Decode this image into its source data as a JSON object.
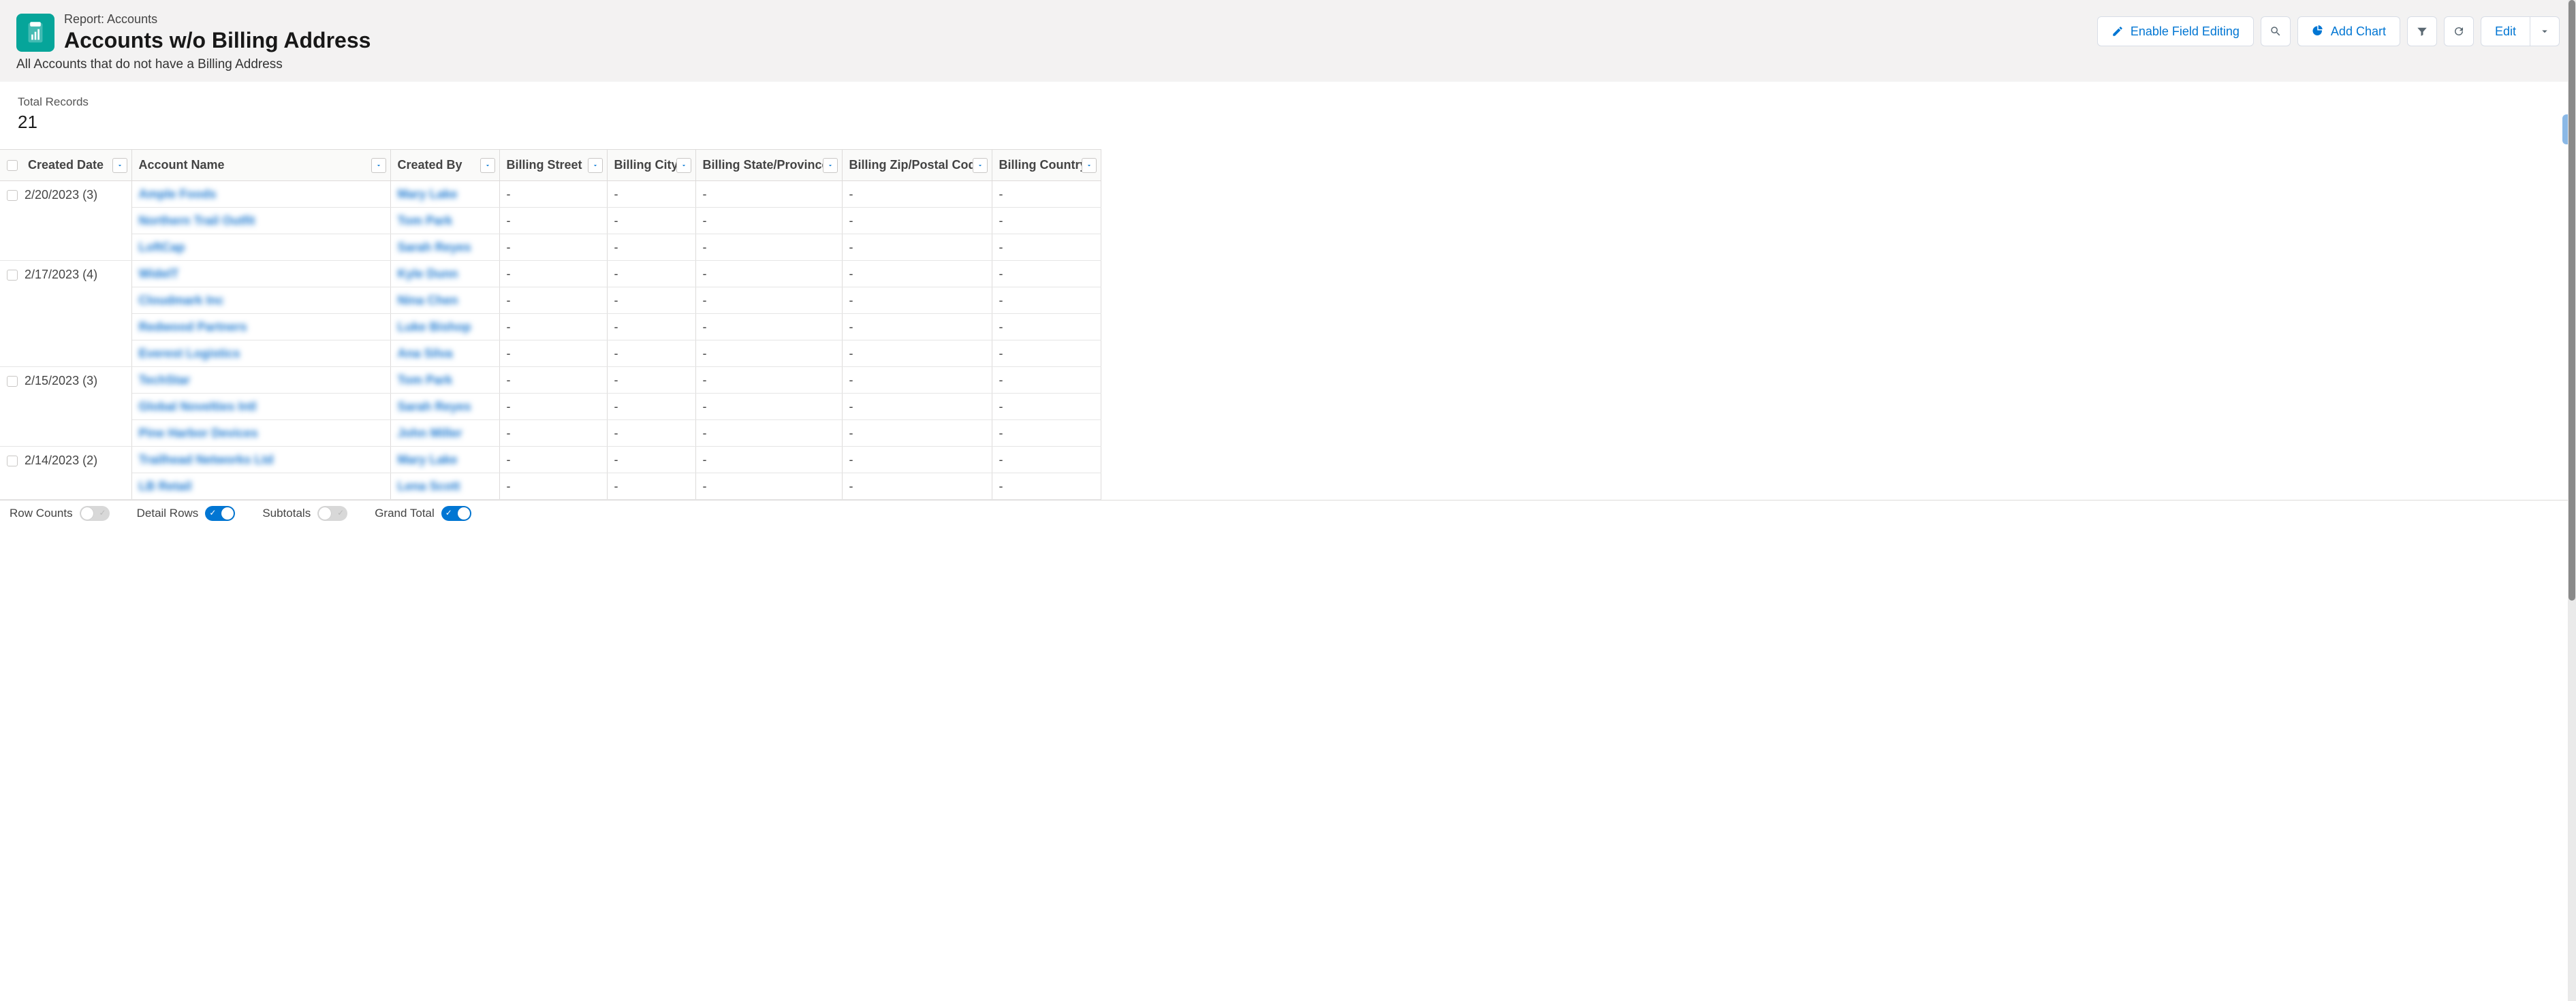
{
  "header": {
    "breadcrumb": "Report: Accounts",
    "title": "Accounts w/o Billing Address",
    "subtitle": "All Accounts that do not have a Billing Address"
  },
  "actions": {
    "enable_field_editing": "Enable Field Editing",
    "add_chart": "Add Chart",
    "edit": "Edit"
  },
  "summary": {
    "total_records_label": "Total Records",
    "total_records_value": "21"
  },
  "columns": {
    "created_date": "Created Date",
    "account_name": "Account Name",
    "created_by": "Created By",
    "billing_street": "Billing Street",
    "billing_city": "Billing City",
    "billing_state": "Billing State/Province",
    "billing_zip": "Billing Zip/Postal Code",
    "billing_country": "Billing Country"
  },
  "groups": [
    {
      "date": "2/20/2023",
      "count": "(3)",
      "rows": [
        {
          "account": "Ample Foods",
          "by": "Mary Lake",
          "street": "-",
          "city": "-",
          "state": "-",
          "zip": "-",
          "country": "-"
        },
        {
          "account": "Northern Trail Outfit",
          "by": "Tom Park",
          "street": "-",
          "city": "-",
          "state": "-",
          "zip": "-",
          "country": "-"
        },
        {
          "account": "LoftCap",
          "by": "Sarah Reyes",
          "street": "-",
          "city": "-",
          "state": "-",
          "zip": "-",
          "country": "-"
        }
      ]
    },
    {
      "date": "2/17/2023",
      "count": "(4)",
      "rows": [
        {
          "account": "WideIT",
          "by": "Kyle Dunn",
          "street": "-",
          "city": "-",
          "state": "-",
          "zip": "-",
          "country": "-"
        },
        {
          "account": "Cloudmark Inc",
          "by": "Nina Chen",
          "street": "-",
          "city": "-",
          "state": "-",
          "zip": "-",
          "country": "-"
        },
        {
          "account": "Redwood Partners",
          "by": "Luke Bishop",
          "street": "-",
          "city": "-",
          "state": "-",
          "zip": "-",
          "country": "-"
        },
        {
          "account": "Everest Logistics",
          "by": "Ana Silva",
          "street": "-",
          "city": "-",
          "state": "-",
          "zip": "-",
          "country": "-"
        }
      ]
    },
    {
      "date": "2/15/2023",
      "count": "(3)",
      "rows": [
        {
          "account": "TechStar",
          "by": "Tom Park",
          "street": "-",
          "city": "-",
          "state": "-",
          "zip": "-",
          "country": "-"
        },
        {
          "account": "Global Novelties Intl",
          "by": "Sarah Reyes",
          "street": "-",
          "city": "-",
          "state": "-",
          "zip": "-",
          "country": "-"
        },
        {
          "account": "Pine Harbor Devices",
          "by": "John Miller",
          "street": "-",
          "city": "-",
          "state": "-",
          "zip": "-",
          "country": "-"
        }
      ]
    },
    {
      "date": "2/14/2023",
      "count": "(2)",
      "rows": [
        {
          "account": "Trailhead Networks Ltd",
          "by": "Mary Lake",
          "street": "-",
          "city": "-",
          "state": "-",
          "zip": "-",
          "country": "-"
        },
        {
          "account": "LB Retail",
          "by": "Lena Scott",
          "street": "-",
          "city": "-",
          "state": "-",
          "zip": "-",
          "country": "-"
        }
      ]
    }
  ],
  "footer": {
    "row_counts": "Row Counts",
    "detail_rows": "Detail Rows",
    "subtotals": "Subtotals",
    "grand_total": "Grand Total",
    "states": {
      "row_counts": false,
      "detail_rows": true,
      "subtotals": false,
      "grand_total": true
    }
  }
}
